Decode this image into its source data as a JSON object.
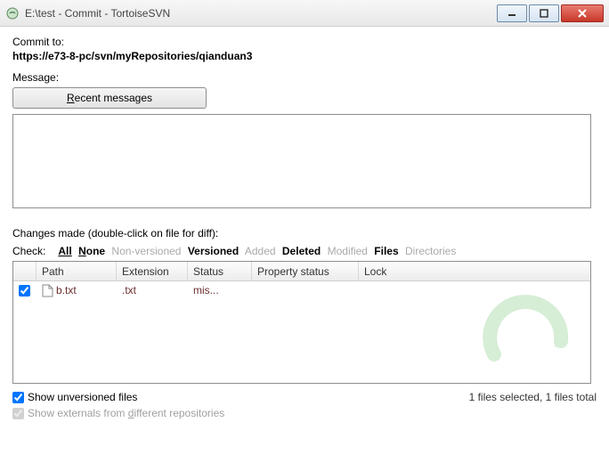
{
  "title": "E:\\test - Commit - TortoiseSVN",
  "commit_to_label": "Commit to:",
  "commit_url": "https://e73-8-pc/svn/myRepositories/qianduan3",
  "message_label": "Message:",
  "recent_btn": "Recent messages",
  "message_value": "",
  "changes_label": "Changes made (double-click on file for diff):",
  "filters": {
    "check": "Check:",
    "all": "All",
    "none": "None",
    "nonversioned": "Non-versioned",
    "versioned": "Versioned",
    "added": "Added",
    "deleted": "Deleted",
    "modified": "Modified",
    "files": "Files",
    "directories": "Directories"
  },
  "columns": {
    "path": "Path",
    "extension": "Extension",
    "status": "Status",
    "property": "Property status",
    "lock": "Lock"
  },
  "rows": [
    {
      "checked": true,
      "path": "b.txt",
      "ext": ".txt",
      "status": "mis...",
      "prop": "",
      "lock": ""
    }
  ],
  "show_unversioned": "Show unversioned files",
  "show_externals": "Show externals from different repositories",
  "status_text": "1 files selected, 1 files total"
}
